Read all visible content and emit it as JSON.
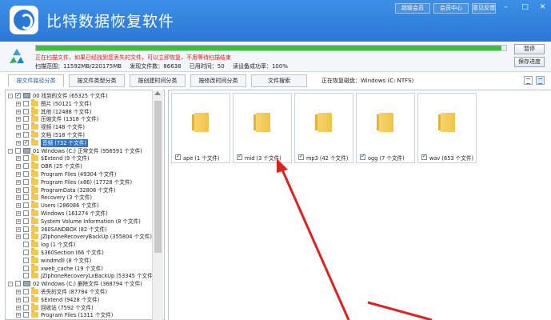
{
  "app": {
    "title": "比特数据恢复软件",
    "header_buttons": [
      "超级会员",
      "会员中心",
      "意见反馈"
    ]
  },
  "status": {
    "progress_percent": 99,
    "message": "正在扫描文件，如果已经找到您丢失的文件，可以立即恢复，不用等待扫描结束",
    "stats": [
      "扫描范围：11592MB/220175MB",
      "发现文件数：86638",
      "已用时间：50",
      "读设备成功率：100%"
    ],
    "pause_label": "暂停",
    "save_label": "保存进度"
  },
  "tabs": [
    "按文件路径分类",
    "按文件类型分类",
    "按创建时间分类",
    "按修改时间分类",
    "文件搜索"
  ],
  "scan_disk": "正在恢复磁盘：Windows (C: NTFS)",
  "tree": [
    {
      "indent": 0,
      "exp": "-",
      "checked": true,
      "icon": "drive",
      "label": "00 找到的文件 (65325 个文件)"
    },
    {
      "indent": 1,
      "exp": "+",
      "checked": false,
      "icon": "folder",
      "label": "图片 (50121 个文件)"
    },
    {
      "indent": 1,
      "exp": "+",
      "checked": false,
      "icon": "folder",
      "label": "其他 (12488 个文件)"
    },
    {
      "indent": 1,
      "exp": "+",
      "checked": false,
      "icon": "folder",
      "label": "压缩文件 (1318 个文件)"
    },
    {
      "indent": 1,
      "exp": "+",
      "checked": false,
      "icon": "folder",
      "label": "视频 (148 个文件)"
    },
    {
      "indent": 1,
      "exp": "+",
      "checked": false,
      "icon": "folder",
      "label": "文档 (518 个文件)"
    },
    {
      "indent": 1,
      "exp": "+",
      "checked": true,
      "icon": "folder",
      "label": "音频 (732 个文件)",
      "selected": true
    },
    {
      "indent": 0,
      "exp": "-",
      "checked": false,
      "icon": "drive",
      "label": "01 Windows (C:) 正常文件 (956591 个文件)"
    },
    {
      "indent": 1,
      "exp": "+",
      "checked": false,
      "icon": "folder",
      "label": "$Extend (9 个文件)"
    },
    {
      "indent": 1,
      "exp": "+",
      "checked": false,
      "icon": "folder",
      "label": "OBR (25 个文件)"
    },
    {
      "indent": 1,
      "exp": "+",
      "checked": false,
      "icon": "folder",
      "label": "Program Files (49304 个文件)"
    },
    {
      "indent": 1,
      "exp": "+",
      "checked": false,
      "icon": "folder",
      "label": "Program Files (x86) (17728 个文件)"
    },
    {
      "indent": 1,
      "exp": "+",
      "checked": false,
      "icon": "folder",
      "label": "ProgramData (32808 个文件)"
    },
    {
      "indent": 1,
      "exp": "+",
      "checked": false,
      "icon": "folder",
      "label": "Recovery (3 个文件)"
    },
    {
      "indent": 1,
      "exp": "+",
      "checked": false,
      "icon": "folder",
      "label": "Users (286086 个文件)"
    },
    {
      "indent": 1,
      "exp": "+",
      "checked": false,
      "icon": "folder",
      "label": "Windows (161274 个文件)"
    },
    {
      "indent": 1,
      "exp": "+",
      "checked": false,
      "icon": "folder",
      "label": "System Volume Information (8 个文件)"
    },
    {
      "indent": 1,
      "exp": "+",
      "checked": false,
      "icon": "folder",
      "label": "360SANDBOX (82 个文件)"
    },
    {
      "indent": 1,
      "exp": "+",
      "checked": false,
      "icon": "folder",
      "label": "JZIphoneRecoveryBackUp (355804 个文件)"
    },
    {
      "indent": 1,
      "exp": "",
      "checked": false,
      "icon": "folder",
      "label": "log (1 个文件)"
    },
    {
      "indent": 1,
      "exp": "",
      "checked": false,
      "icon": "folder",
      "label": "$360Section (66 个文件)"
    },
    {
      "indent": 1,
      "exp": "",
      "checked": false,
      "icon": "folder",
      "label": "windmdll (8 个文件)"
    },
    {
      "indent": 1,
      "exp": "",
      "checked": false,
      "icon": "folder",
      "label": "xweb_cache (19 个文件)"
    },
    {
      "indent": 1,
      "exp": "",
      "checked": false,
      "icon": "folder",
      "label": "JZIphoneRecoveryLxBackUp (53345 个文件)"
    },
    {
      "indent": 0,
      "exp": "-",
      "checked": false,
      "icon": "drive",
      "label": "02 Windows (C:) 删除文件 (368794 个文件)"
    },
    {
      "indent": 1,
      "exp": "+",
      "checked": false,
      "icon": "folder",
      "label": "丢失的文件 (87784 个文件)"
    },
    {
      "indent": 1,
      "exp": "+",
      "checked": false,
      "icon": "folder",
      "label": "$Extend (9428 个文件)"
    },
    {
      "indent": 1,
      "exp": "+",
      "checked": false,
      "icon": "folder",
      "label": "回收站 (7592 个文件)"
    },
    {
      "indent": 1,
      "exp": "+",
      "checked": false,
      "icon": "folder",
      "label": "Program Files (1311 个文件)"
    }
  ],
  "cards": [
    "ape (1 个文件)",
    "mid (3 个文件)",
    "mp3 (42 个文件)",
    "ogg (7 个文件)",
    "wav (653 个文件)"
  ],
  "colors": {
    "titlebar": "#2a78d6",
    "status_message": "#e02020",
    "progress": "#3fbf3f",
    "selection": "#3074c8",
    "annotation_arrow": "#e02020"
  }
}
